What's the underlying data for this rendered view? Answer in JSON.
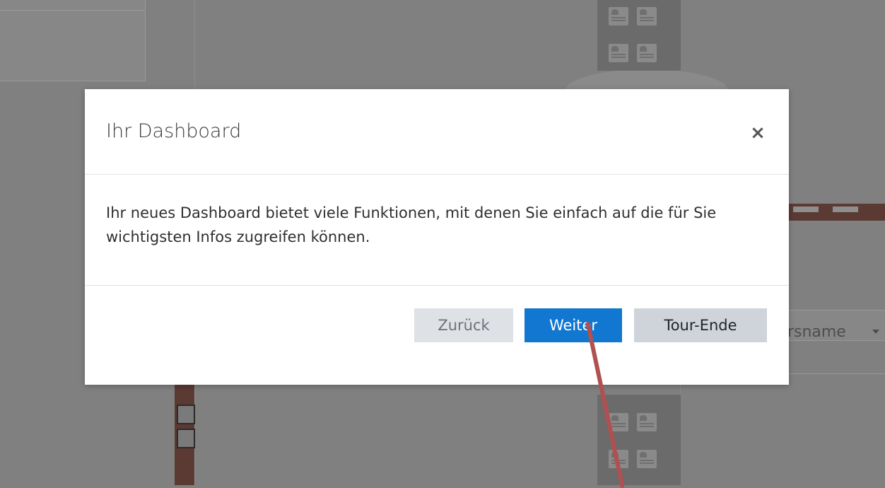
{
  "background": {
    "sort_label": "ursname",
    "overlay_color": "#808080"
  },
  "modal": {
    "title": "Ihr Dashboard",
    "close_symbol": "×",
    "body": "Ihr neues Dashboard bietet viele Funktionen, mit denen Sie einfach auf die für Sie wichtigsten Infos zugreifen können.",
    "buttons": {
      "back": "Zurück",
      "next": "Weiter",
      "end": "Tour-Ende"
    },
    "accent_color": "#1177d1"
  },
  "icons": {
    "close": "close-icon",
    "tiles": "user-card-icon"
  }
}
